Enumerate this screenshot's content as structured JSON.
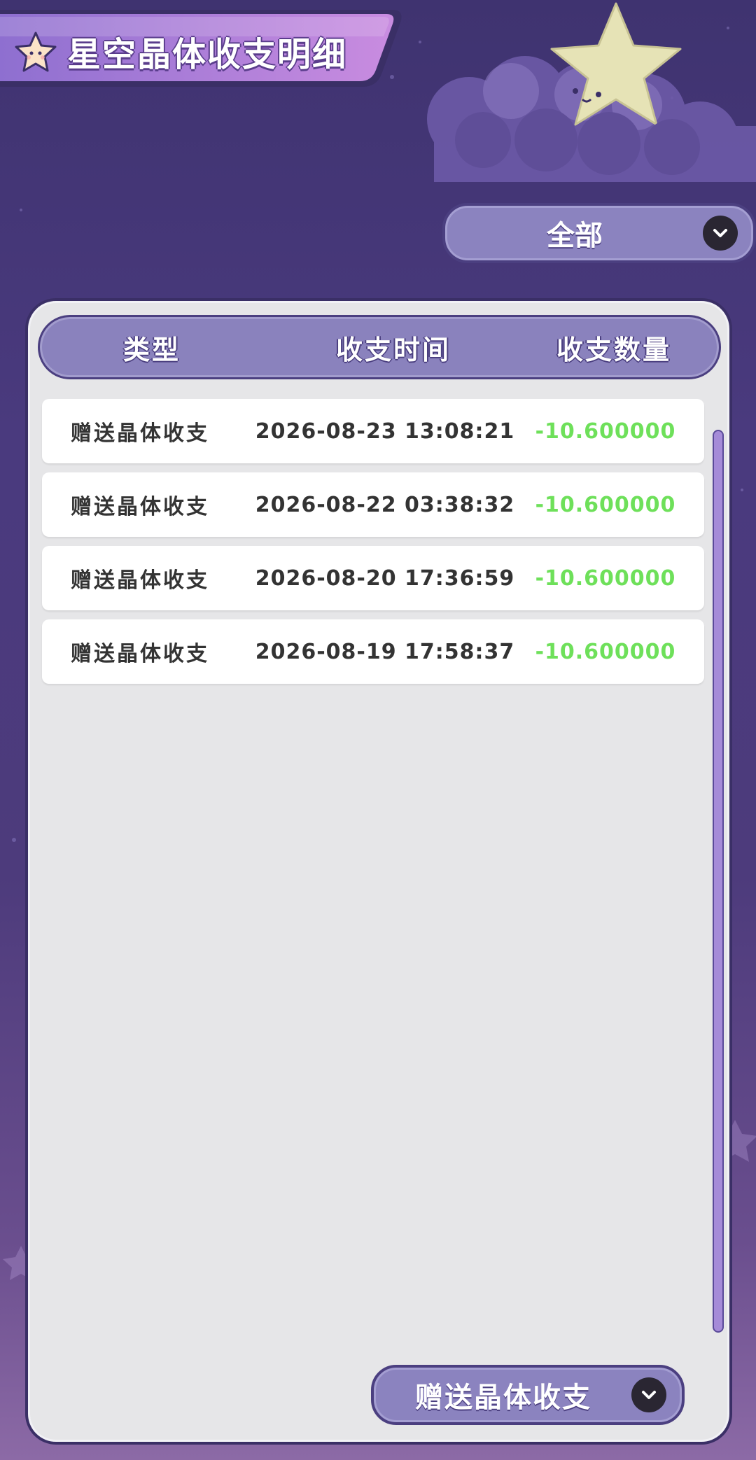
{
  "header": {
    "title": "星空晶体收支明细"
  },
  "filter": {
    "selected": "全部"
  },
  "table": {
    "columns": [
      "类型",
      "收支时间",
      "收支数量"
    ],
    "rows": [
      {
        "type": "赠送晶体收支",
        "time": "2026-08-23 13:08:21",
        "amount": "-10.600000"
      },
      {
        "type": "赠送晶体收支",
        "time": "2026-08-22 03:38:32",
        "amount": "-10.600000"
      },
      {
        "type": "赠送晶体收支",
        "time": "2026-08-20 17:36:59",
        "amount": "-10.600000"
      },
      {
        "type": "赠送晶体收支",
        "time": "2026-08-19 17:58:37",
        "amount": "-10.600000"
      }
    ]
  },
  "type_filter": {
    "selected": "赠送晶体收支"
  },
  "icons": {
    "title": "star-icon",
    "dropdown": "chevron-down-icon"
  },
  "colors": {
    "amount": "#6ee05a",
    "accent": "#8b83bf",
    "background": "#3f3370"
  }
}
